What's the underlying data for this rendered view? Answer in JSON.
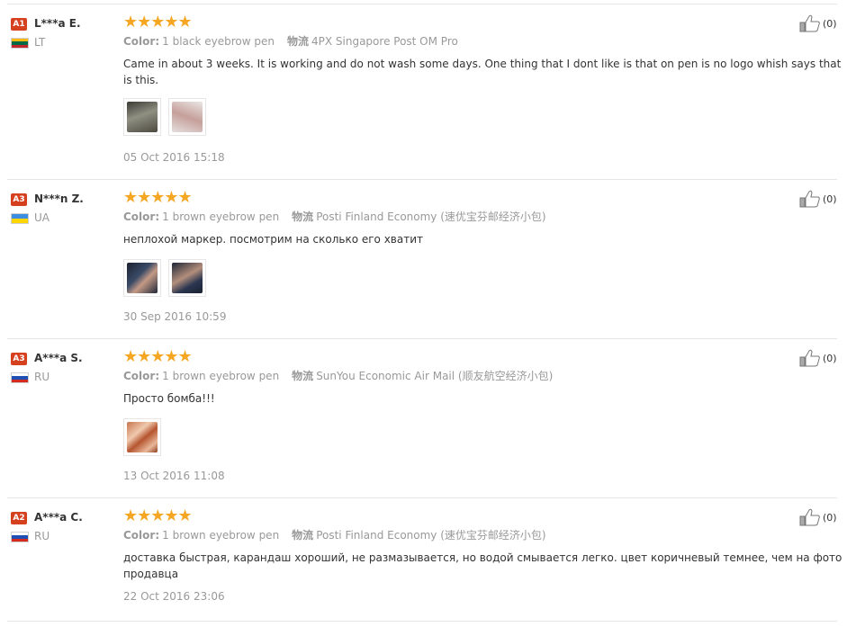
{
  "labels": {
    "color": "Color:",
    "logistics": "物流"
  },
  "reviews": [
    {
      "level": "A1",
      "name": "L***a E.",
      "country": "LT",
      "color": "1 black eyebrow pen",
      "shipping": "4PX Singapore Post OM Pro",
      "text": "Came in about 3 weeks. It is working and do not wash some days. One thing that I dont like is that on pen is no logo whish says that is this.",
      "date": "05 Oct 2016 15:18",
      "likes": "(0)",
      "stars": 5,
      "photos": 2
    },
    {
      "level": "A3",
      "name": "N***n Z.",
      "country": "UA",
      "color": "1 brown eyebrow pen",
      "shipping": "Posti Finland Economy (速优宝芬邮经济小包)",
      "text": "неплохой маркер. посмотрим на сколько его хватит",
      "date": "30 Sep 2016 10:59",
      "likes": "(0)",
      "stars": 5,
      "photos": 2
    },
    {
      "level": "A3",
      "name": "A***a S.",
      "country": "RU",
      "color": "1 brown eyebrow pen",
      "shipping": "SunYou Economic Air Mail (顺友航空经济小包)",
      "text": "Просто бомба!!!",
      "date": "13 Oct 2016 11:08",
      "likes": "(0)",
      "stars": 5,
      "photos": 1
    },
    {
      "level": "A2",
      "name": "A***a C.",
      "country": "RU",
      "color": "1 brown eyebrow pen",
      "shipping": "Posti Finland Economy (速优宝芬邮经济小包)",
      "text": "доставка быстрая, карандаш хороший, не размазывается, но водой смывается легко. цвет коричневый темнее, чем на фото продавца",
      "date": "22 Oct 2016 23:06",
      "likes": "(0)",
      "stars": 5,
      "photos": 0
    }
  ],
  "flags": {
    "LT": [
      "#fdb913",
      "#006a44",
      "#c1272d"
    ],
    "UA": [
      "#3d8de0",
      "#ffd500"
    ],
    "RU": [
      "#ffffff",
      "#1f4fb5",
      "#d52b1e"
    ]
  },
  "colors": {
    "accent": "#d5401f",
    "star": "#f5a623",
    "muted": "#999999"
  }
}
